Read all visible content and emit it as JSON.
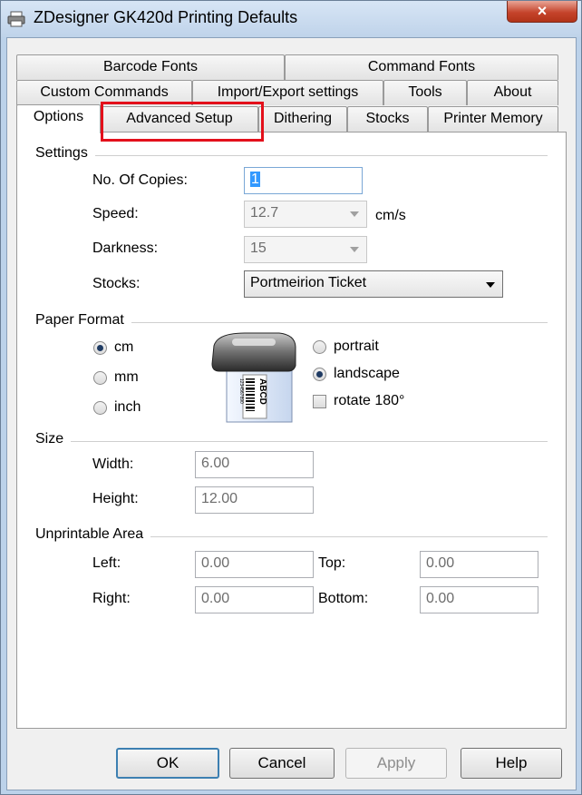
{
  "window": {
    "title": "ZDesigner GK420d Printing Defaults",
    "close_label": "×"
  },
  "tabs": {
    "row1": [
      "Barcode Fonts",
      "Command Fonts"
    ],
    "row2": [
      "Custom Commands",
      "Import/Export settings",
      "Tools",
      "About"
    ],
    "row3": [
      "Options",
      "Advanced Setup",
      "Dithering",
      "Stocks",
      "Printer Memory"
    ],
    "active": "Options",
    "highlighted": "Advanced Setup"
  },
  "settings": {
    "section": "Settings",
    "copies_label": "No. Of Copies:",
    "copies_value": "1",
    "speed_label": "Speed:",
    "speed_value": "12.7",
    "speed_unit": "cm/s",
    "darkness_label": "Darkness:",
    "darkness_value": "15",
    "stocks_label": "Stocks:",
    "stocks_value": "Portmeirion Ticket"
  },
  "paper_format": {
    "section": "Paper Format",
    "units": [
      {
        "label": "cm",
        "checked": true
      },
      {
        "label": "mm",
        "checked": false
      },
      {
        "label": "inch",
        "checked": false
      }
    ],
    "orientation": [
      {
        "label": "portrait",
        "checked": false
      },
      {
        "label": "landscape",
        "checked": true
      }
    ],
    "rotate_label": "rotate 180°",
    "rotate_checked": false,
    "label_preview_text": "ABCD",
    "label_preview_number": "1234567890"
  },
  "size": {
    "section": "Size",
    "width_label": "Width:",
    "width_value": "6.00",
    "height_label": "Height:",
    "height_value": "12.00"
  },
  "unprintable": {
    "section": "Unprintable Area",
    "left_label": "Left:",
    "left_value": "0.00",
    "top_label": "Top:",
    "top_value": "0.00",
    "right_label": "Right:",
    "right_value": "0.00",
    "bottom_label": "Bottom:",
    "bottom_value": "0.00"
  },
  "buttons": {
    "ok": "OK",
    "cancel": "Cancel",
    "apply": "Apply",
    "help": "Help"
  },
  "colors": {
    "highlight": "#e3101b",
    "selection": "#3399ff",
    "close_button": "#c5442c"
  }
}
